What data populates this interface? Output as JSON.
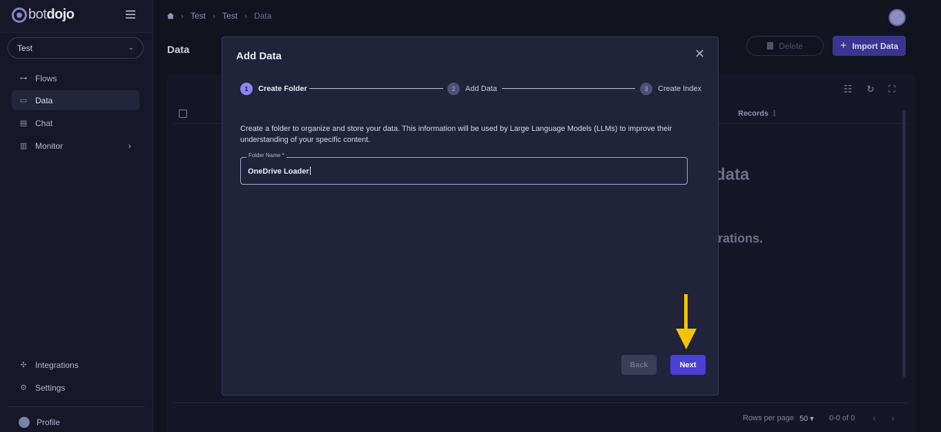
{
  "app": {
    "logo_light": "bot",
    "logo_bold": "dojo"
  },
  "sidebar": {
    "workspace": "Test",
    "items": [
      {
        "label": "Flows",
        "icon": "flows-icon"
      },
      {
        "label": "Data",
        "icon": "folder-icon"
      },
      {
        "label": "Chat",
        "icon": "chat-icon"
      },
      {
        "label": "Monitor",
        "icon": "chart-icon"
      }
    ],
    "bottom_items": [
      {
        "label": "Integrations",
        "icon": "puzzle-icon"
      },
      {
        "label": "Settings",
        "icon": "gear-icon"
      },
      {
        "label": "Profile",
        "icon": "profile-icon"
      }
    ]
  },
  "breadcrumb": [
    "Test",
    "Test",
    "Data"
  ],
  "page": {
    "title": "Data",
    "delete_label": "Delete",
    "import_label": "Import Data",
    "records_header": "Records",
    "bg_text_1": "data",
    "bg_text_2": "rations.",
    "rows_per_page_label": "Rows per page",
    "rows_per_page_value": "50",
    "pagination": "0-0 of 0"
  },
  "modal": {
    "title": "Add Data",
    "steps": [
      {
        "num": "1",
        "label": "Create Folder"
      },
      {
        "num": "2",
        "label": "Add Data"
      },
      {
        "num": "3",
        "label": "Create Index"
      }
    ],
    "description": "Create a folder to organize and store your data. This information will be used by Large Language Models (LLMs) to improve their understanding of your specific content.",
    "field_label": "Folder Name *",
    "field_value": "OneDrive Loader",
    "back_label": "Back",
    "next_label": "Next"
  },
  "colors": {
    "accent": "#4b3fd6",
    "annotation_arrow": "#f5c400"
  }
}
